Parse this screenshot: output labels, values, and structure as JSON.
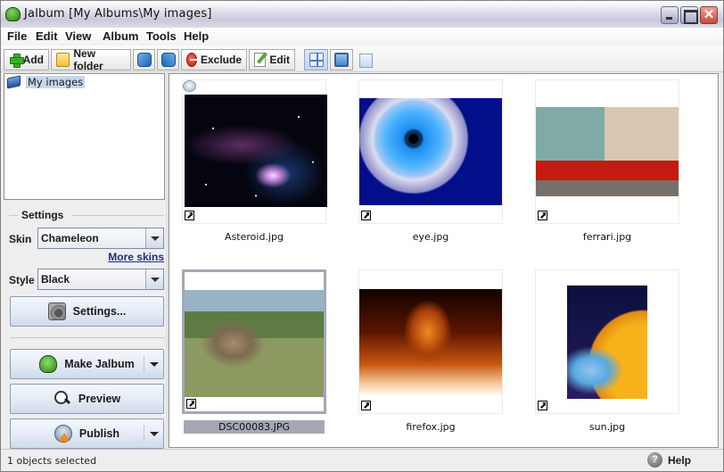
{
  "window": {
    "title": "Jalbum [My Albums\\My images]",
    "controls": {
      "minimize": "minimize",
      "maximize": "maximize",
      "close": "✕"
    }
  },
  "menu": [
    "File",
    "Edit",
    "View",
    "Album",
    "Tools",
    "Help"
  ],
  "toolbar": {
    "add": "Add",
    "new_folder": "New folder",
    "rotate_left": "rotate-left",
    "rotate_right": "rotate-right",
    "exclude": "Exclude",
    "edit": "Edit",
    "view_thumbnails": "thumbnail-view",
    "view_single": "single-image-view",
    "slideshow": "slideshow"
  },
  "tree": {
    "root": "My images"
  },
  "settings": {
    "legend": "Settings",
    "skin_label": "Skin",
    "skin_value": "Chameleon",
    "more_skins": "More skins",
    "style_label": "Style",
    "style_value": "Black",
    "settings_button": "Settings..."
  },
  "actions": {
    "make_album": "Make Jalbum",
    "preview": "Preview",
    "publish": "Publish"
  },
  "thumbnails": [
    {
      "name": "Asteroid.jpg",
      "selected": false,
      "has_comment": true,
      "linked": true
    },
    {
      "name": "eye.jpg",
      "selected": false,
      "has_comment": false,
      "linked": true
    },
    {
      "name": "ferrari.jpg",
      "selected": false,
      "has_comment": false,
      "linked": true
    },
    {
      "name": "DSC00083.JPG",
      "selected": true,
      "has_comment": false,
      "linked": true
    },
    {
      "name": "firefox.jpg",
      "selected": false,
      "has_comment": false,
      "linked": true
    },
    {
      "name": "sun.jpg",
      "selected": false,
      "has_comment": false,
      "linked": true
    }
  ],
  "status": {
    "text": "1 objects selected",
    "help": "Help",
    "help_glyph": "?"
  },
  "colors": {
    "selection": "#a4a7b4",
    "tree_selection": "#c6d7ea",
    "link": "#1e2c8a"
  }
}
